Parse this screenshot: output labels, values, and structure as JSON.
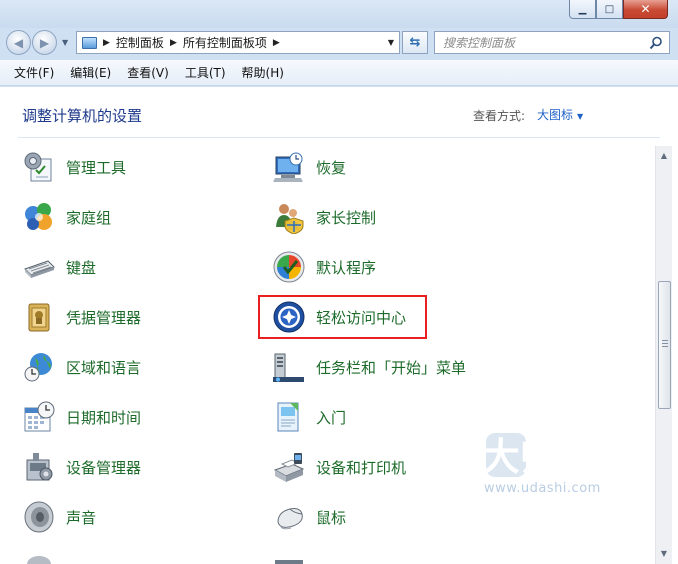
{
  "window": {
    "buttons": {
      "minimize": "▁",
      "maximize": "□",
      "close": "✕"
    }
  },
  "address": {
    "breadcrumbs": [
      "控制面板",
      "所有控制面板项"
    ],
    "search_placeholder": "搜索控制面板"
  },
  "menu": [
    "文件(F)",
    "编辑(E)",
    "查看(V)",
    "工具(T)",
    "帮助(H)"
  ],
  "content": {
    "heading": "调整计算机的设置",
    "view_by_label": "查看方式:",
    "view_by_value": "大图标"
  },
  "items_left": [
    {
      "label": "管理工具",
      "icon": "admin-tools-icon"
    },
    {
      "label": "家庭组",
      "icon": "homegroup-icon"
    },
    {
      "label": "键盘",
      "icon": "keyboard-icon"
    },
    {
      "label": "凭据管理器",
      "icon": "credential-manager-icon"
    },
    {
      "label": "区域和语言",
      "icon": "region-language-icon"
    },
    {
      "label": "日期和时间",
      "icon": "date-time-icon"
    },
    {
      "label": "设备管理器",
      "icon": "device-manager-icon"
    },
    {
      "label": "声音",
      "icon": "sound-icon"
    }
  ],
  "items_right": [
    {
      "label": "恢复",
      "icon": "recovery-icon"
    },
    {
      "label": "家长控制",
      "icon": "parental-controls-icon"
    },
    {
      "label": "默认程序",
      "icon": "default-programs-icon"
    },
    {
      "label": "轻松访问中心",
      "icon": "ease-of-access-icon",
      "highlighted": true
    },
    {
      "label": "任务栏和「开始」菜单",
      "icon": "taskbar-start-menu-icon"
    },
    {
      "label": "入门",
      "icon": "getting-started-icon"
    },
    {
      "label": "设备和打印机",
      "icon": "devices-printers-icon"
    },
    {
      "label": "鼠标",
      "icon": "mouse-icon"
    }
  ],
  "watermark": {
    "logo_text": "U大师",
    "site": "www.udashi.com"
  },
  "colors": {
    "item_label": "#1d6b2a",
    "heading": "#1e3a8c",
    "link": "#1e62c8",
    "highlight": "#e8201f"
  }
}
